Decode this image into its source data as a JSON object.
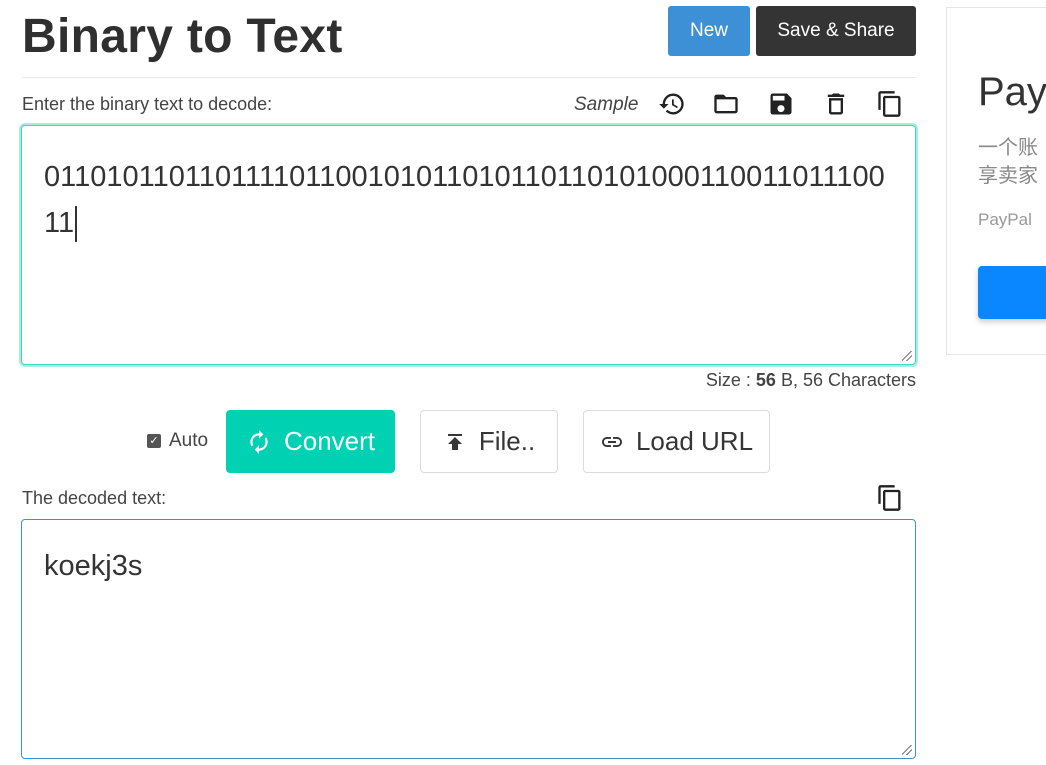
{
  "header": {
    "title": "Binary to Text",
    "new_label": "New",
    "share_label": "Save & Share"
  },
  "input": {
    "label": "Enter the binary text to decode:",
    "sample_label": "Sample",
    "value": "01101011011011110110010101101011011010100011001101110011",
    "size_prefix": "Size : ",
    "size_value": "56",
    "size_suffix": " B, 56 Characters",
    "toolbar_icons": [
      "history-icon",
      "open-folder-icon",
      "save-icon",
      "delete-icon",
      "copy-icon"
    ]
  },
  "actions": {
    "auto_label": "Auto",
    "auto_checked": true,
    "convert_label": "Convert",
    "file_label": "File..",
    "load_url_label": "Load URL"
  },
  "output": {
    "label": "The decoded text:",
    "value": "koekj3s"
  },
  "ad": {
    "title": "Pay",
    "body_line1": "一个账",
    "body_line2": "享卖家",
    "source": "PayPal"
  },
  "colors": {
    "primary": "#3d8fd6",
    "dark": "#343434",
    "accent": "#00d1b2"
  }
}
